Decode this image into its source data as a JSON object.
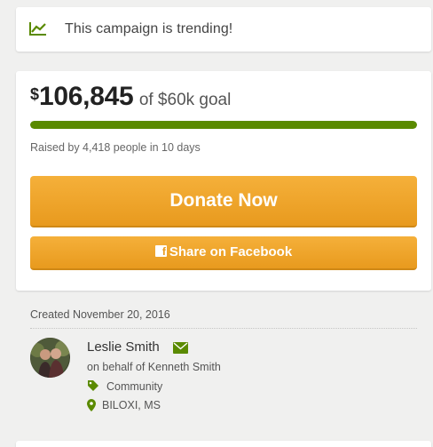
{
  "trending": {
    "text": "This campaign is trending!",
    "icon": "trending-chart-icon"
  },
  "funding": {
    "currency_symbol": "$",
    "amount": "106,845",
    "goal_text": "of $60k goal",
    "progress_fraction": 1.0,
    "raised_by_text": "Raised by 4,418 people in 10 days"
  },
  "actions": {
    "donate_label": "Donate Now",
    "share_label": "Share on Facebook",
    "share_icon": "facebook-icon"
  },
  "campaign": {
    "created_text": "Created November 20, 2016"
  },
  "organizer": {
    "name": "Leslie Smith",
    "behalf_text": "on behalf of Kenneth Smith",
    "category": "Community",
    "location": "BILOXI, MS"
  },
  "colors": {
    "accent_green": "#5a8a00",
    "button_orange": "#f0a32c",
    "background": "#f0f0ef"
  }
}
